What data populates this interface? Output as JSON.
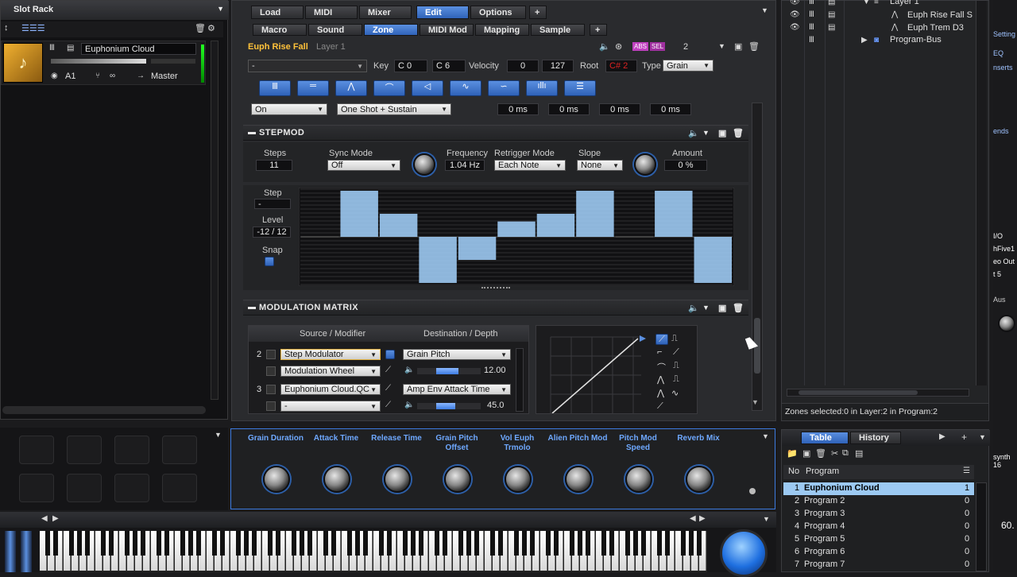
{
  "slot_rack": {
    "title": "Slot Rack",
    "slot": {
      "name": "Euphonium Cloud",
      "midi_channel": "A1",
      "output": "Master"
    }
  },
  "top_tabs": [
    "Load",
    "MIDI",
    "Mixer",
    "Edit",
    "Options"
  ],
  "sub_tabs": [
    "Macro",
    "Sound",
    "Zone",
    "MIDI Mod",
    "Mapping",
    "Sample"
  ],
  "zone_header": {
    "name": "Euph Rise Fall",
    "layer": "Layer 1",
    "badges": [
      "ABS",
      "SEL"
    ],
    "count": "2"
  },
  "key_row": {
    "preset": "-",
    "key_label": "Key",
    "key_low": "C 0",
    "key_high": "C 6",
    "velocity_label": "Velocity",
    "vel_low": "0",
    "vel_high": "127",
    "root_label": "Root",
    "root": "C# 2",
    "type_label": "Type",
    "type": "Grain"
  },
  "env_row": {
    "mode_a": "On",
    "mode_b": "One Shot + Sustain",
    "times": [
      "0 ms",
      "0 ms",
      "0 ms",
      "0 ms"
    ]
  },
  "stepmod": {
    "title": "STEPMOD",
    "steps_label": "Steps",
    "steps": "11",
    "sync_label": "Sync Mode",
    "sync": "Off",
    "freq_label": "Frequency",
    "freq": "1.04 Hz",
    "retrig_label": "Retrigger Mode",
    "retrig": "Each Note",
    "slope_label": "Slope",
    "slope": "None",
    "amount_label": "Amount",
    "amount": "0 %",
    "step_label": "Step",
    "step": "-",
    "level_label": "Level",
    "level": "-12 / 12",
    "snap_label": "Snap",
    "step_values": [
      0,
      12,
      6,
      -12,
      -6,
      4,
      6,
      12,
      0,
      12,
      -12
    ]
  },
  "mod_matrix": {
    "title": "MODULATION MATRIX",
    "col_source": "Source / Modifier",
    "col_dest": "Destination / Depth",
    "rows": [
      {
        "num": "2",
        "source": "Step Modulator",
        "modifier": "Modulation Wheel",
        "dest": "Grain Pitch",
        "depth": "12.00",
        "depth_pct": 0.35
      },
      {
        "num": "3",
        "source": "Euphonium Cloud.QC",
        "modifier": "-",
        "dest": "Amp Env Attack Time",
        "depth": "45.0",
        "depth_pct": 0.3
      }
    ]
  },
  "quick_controls": [
    {
      "label": "Grain Duration"
    },
    {
      "label": "Attack Time"
    },
    {
      "label": "Release Time"
    },
    {
      "label": "Grain Pitch Offset"
    },
    {
      "label": "Vol Euph Trmolo"
    },
    {
      "label": "Alien Pitch Mod"
    },
    {
      "label": "Pitch Mod Speed"
    },
    {
      "label": "Reverb Mix"
    }
  ],
  "tree": {
    "items": [
      {
        "label": "Layer 1"
      },
      {
        "label": "Euph Rise Fall S"
      },
      {
        "label": "Euph Trem D3"
      },
      {
        "label": "Program-Bus"
      }
    ],
    "status": "Zones selected:0  in Layer:2  in Program:2"
  },
  "browser": {
    "tabs": [
      "Table",
      "History"
    ],
    "col_no": "No",
    "col_program": "Program",
    "rows": [
      {
        "no": "1",
        "name": "Euphonium Cloud",
        "val": "1"
      },
      {
        "no": "2",
        "name": "Program 2",
        "val": "0"
      },
      {
        "no": "3",
        "name": "Program 3",
        "val": "0"
      },
      {
        "no": "4",
        "name": "Program 4",
        "val": "0"
      },
      {
        "no": "5",
        "name": "Program 5",
        "val": "0"
      },
      {
        "no": "6",
        "name": "Program 6",
        "val": "0"
      },
      {
        "no": "7",
        "name": "Program 7",
        "val": "0"
      }
    ]
  },
  "right_edge": {
    "items": [
      "Setting",
      "EQ",
      "nserts",
      "ends",
      "I/O",
      "hFive1",
      "eo Out",
      "t 5",
      "Aus",
      "synth",
      "16",
      "60."
    ]
  },
  "colors": {
    "accent": "#3d7be0",
    "selection": "#9cc9f2",
    "step_bar": "#9cc9f2"
  }
}
